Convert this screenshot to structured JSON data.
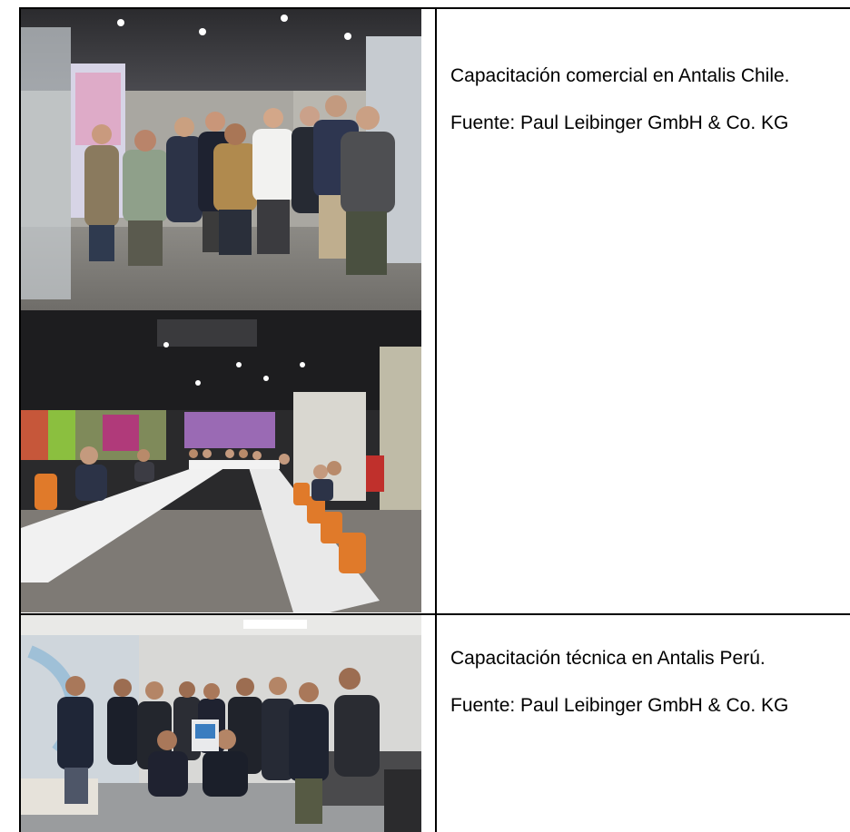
{
  "rows": [
    {
      "caption": "Capacitación comercial en Antalis Chile.",
      "source": "Fuente: Paul Leibinger GmbH & Co. KG",
      "photos": [
        "group-photo-office-hallway",
        "conference-room-training-session"
      ]
    },
    {
      "caption": "Capacitación técnica en Antalis Perú.",
      "source": "Fuente: Paul Leibinger GmbH & Co. KG",
      "photos": [
        "group-photo-training-room"
      ]
    }
  ]
}
